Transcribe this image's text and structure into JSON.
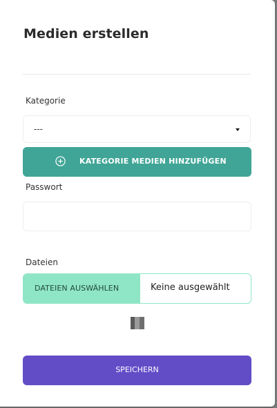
{
  "dialog": {
    "title": "Medien erstellen"
  },
  "category": {
    "label": "Kategorie",
    "selected": "---",
    "add_button_label": "KATEGORIE MEDIEN HINZUFÜGEN"
  },
  "password": {
    "label": "Passwort",
    "value": ""
  },
  "files": {
    "label": "Dateien",
    "choose_button_label": "DATEIEN AUSWÄHLEN",
    "status": "Keine ausgewählt"
  },
  "actions": {
    "save_label": "SPEICHERN"
  },
  "colors": {
    "add_button": "#40a596",
    "file_button": "#8fe6c6",
    "save_button": "#634dc7"
  },
  "icons": {
    "add": "plus-circle-icon",
    "preview": "image-placeholder-icon",
    "dropdown": "caret-down-icon"
  }
}
